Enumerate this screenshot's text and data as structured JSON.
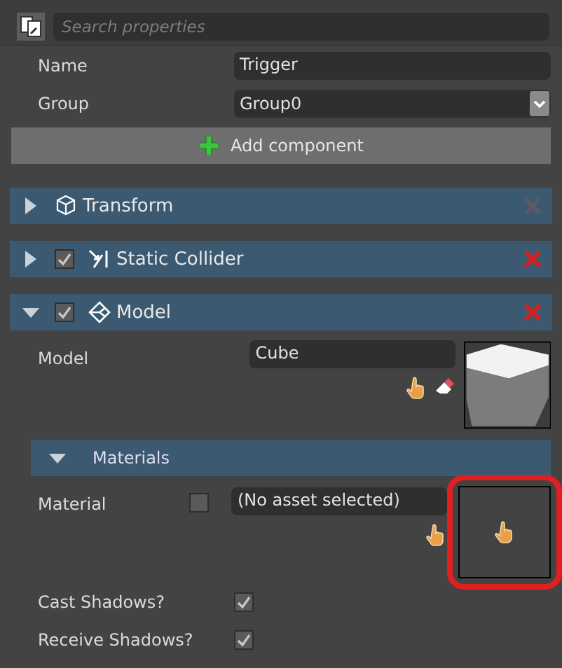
{
  "toolbar": {
    "search": {
      "placeholder": "Search properties"
    }
  },
  "properties": [
    {
      "label": "Name",
      "value": "Trigger",
      "kind": "text"
    },
    {
      "label": "Group",
      "value": "Group0",
      "kind": "dropdown"
    }
  ],
  "add_button": {
    "label": "Add component"
  },
  "components": [
    {
      "title": "Transform",
      "kind": "transform",
      "expanded": false,
      "removable": false
    },
    {
      "title": "Static Collider",
      "kind": "collider",
      "expanded": false,
      "enabled": true,
      "removable": true
    },
    {
      "title": "Model",
      "kind": "model",
      "expanded": true,
      "enabled": true,
      "removable": true,
      "model": {
        "label": "Model",
        "value": "Cube"
      },
      "materials": {
        "title": "Materials",
        "expanded": true,
        "items": [
          {
            "label": "Material",
            "checked": false,
            "value": "(No asset selected)",
            "highlighted": true
          }
        ]
      },
      "options": [
        {
          "label": "Cast Shadows?",
          "checked": true
        },
        {
          "label": "Receive Shadows?",
          "checked": true
        }
      ]
    }
  ]
}
